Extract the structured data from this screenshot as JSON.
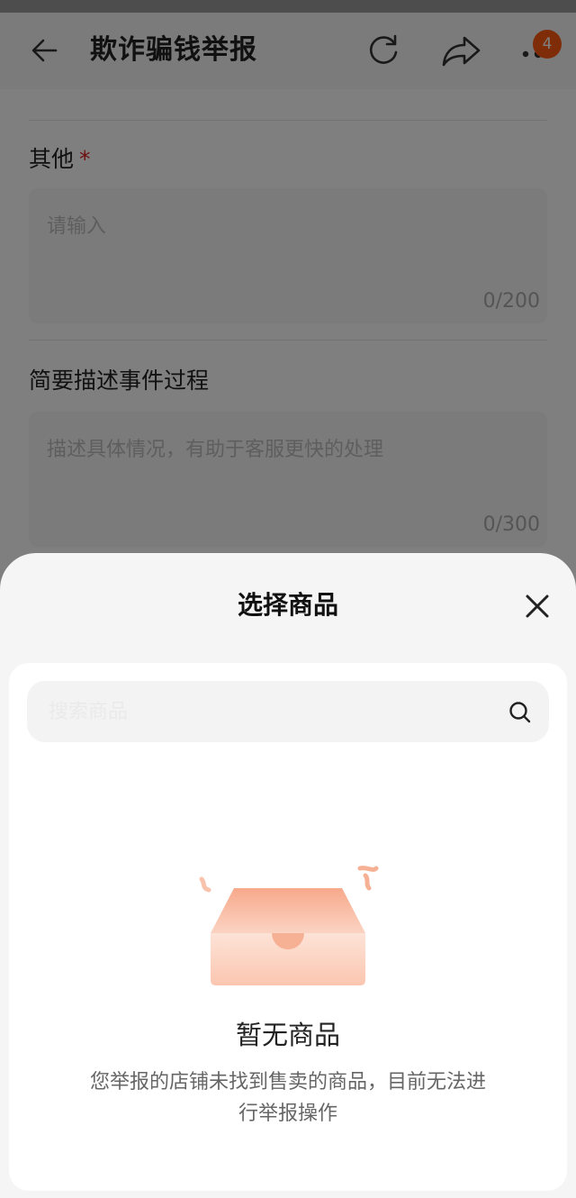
{
  "header": {
    "title": "欺诈骗钱举报",
    "badge_count": "4",
    "icons": [
      "back-arrow-icon",
      "refresh-icon",
      "share-icon",
      "more-dots-icon"
    ]
  },
  "form": {
    "other": {
      "label": "其他",
      "required_mark": "*",
      "placeholder": "请输入",
      "counter": "0/200"
    },
    "description": {
      "label": "简要描述事件过程",
      "placeholder": "描述具体情况，有助于客服更快的处理",
      "counter": "0/300"
    }
  },
  "sheet": {
    "title": "选择商品",
    "search_placeholder": "搜索商品",
    "empty_title": "暂无商品",
    "empty_desc": "您举报的店铺未找到售卖的商品，目前无法进行举报操作"
  },
  "colors": {
    "accent": "#ff5a13",
    "required": "#e02020",
    "illustration": "#f9b49a"
  }
}
